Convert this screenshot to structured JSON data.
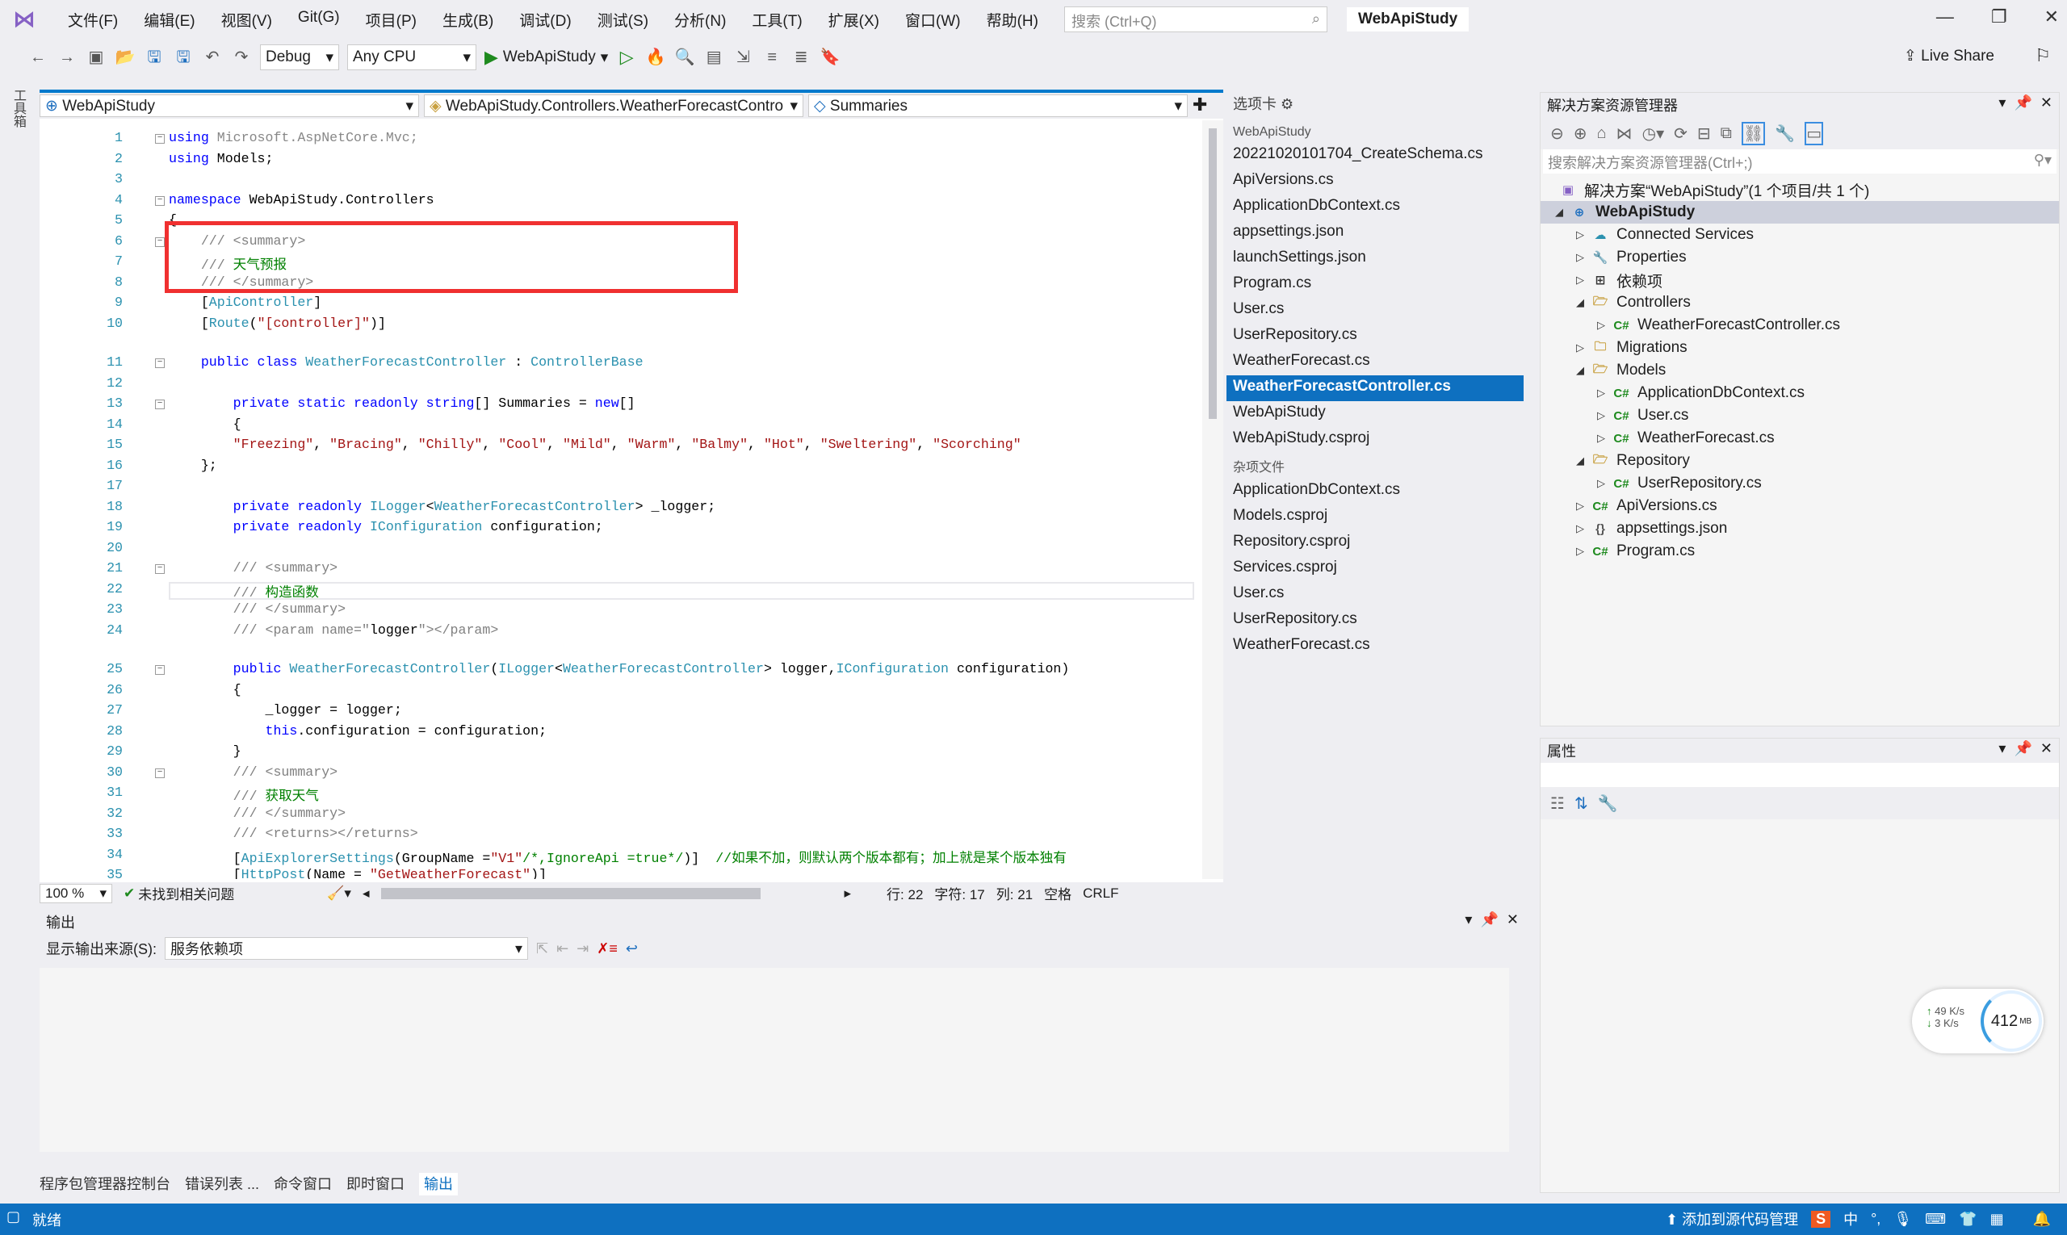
{
  "menubar": {
    "items": [
      "文件(F)",
      "编辑(E)",
      "视图(V)",
      "Git(G)",
      "项目(P)",
      "生成(B)",
      "调试(D)",
      "测试(S)",
      "分析(N)",
      "工具(T)",
      "扩展(X)",
      "窗口(W)",
      "帮助(H)"
    ],
    "search_placeholder": "搜索 (Ctrl+Q)",
    "title": "WebApiStudy"
  },
  "toolbar": {
    "config": "Debug",
    "platform": "Any CPU",
    "run_target": "WebApiStudy",
    "live_share": "Live Share"
  },
  "left_rail": {
    "label": "工具箱"
  },
  "editor": {
    "nav": {
      "project": "WebApiStudy",
      "class": "WebApiStudy.Controllers.WeatherForecastContro",
      "member": "Summaries"
    },
    "lines": [
      [
        [
          "kw",
          "using"
        ],
        [
          "fd",
          " Microsoft.AspNetCore.Mvc;"
        ]
      ],
      [
        [
          "kw",
          "using"
        ],
        [
          "tx",
          " Models;"
        ]
      ],
      [],
      [
        [
          "kw",
          "namespace"
        ],
        [
          "tx",
          " WebApiStudy.Controllers"
        ]
      ],
      [
        [
          "tx",
          "{"
        ]
      ],
      [
        [
          "dc",
          "    /// <summary>"
        ]
      ],
      [
        [
          "dc",
          "    /// "
        ],
        [
          "cm",
          "天气预报"
        ]
      ],
      [
        [
          "dc",
          "    /// </summary>"
        ]
      ],
      [
        [
          "tx",
          "    ["
        ],
        [
          "ty",
          "ApiController"
        ],
        [
          "tx",
          "]"
        ]
      ],
      [
        [
          "tx",
          "    ["
        ],
        [
          "ty",
          "Route"
        ],
        [
          "tx",
          "("
        ],
        [
          "st",
          "\"[controller]\""
        ],
        [
          "tx",
          ")]"
        ]
      ],
      [
        [
          "kw",
          "    public class "
        ],
        [
          "ty",
          "WeatherForecastController"
        ],
        [
          "tx",
          " : "
        ],
        [
          "ty",
          "ControllerBase"
        ]
      ],
      [],
      [
        [
          "kw",
          "        private static readonly string"
        ],
        [
          "tx",
          "[] Summaries = "
        ],
        [
          "kw",
          "new"
        ],
        [
          "tx",
          "[]"
        ]
      ],
      [
        [
          "tx",
          "        {"
        ]
      ],
      [
        [
          "st",
          "        \"Freezing\""
        ],
        [
          "tx",
          ", "
        ],
        [
          "st",
          "\"Bracing\""
        ],
        [
          "tx",
          ", "
        ],
        [
          "st",
          "\"Chilly\""
        ],
        [
          "tx",
          ", "
        ],
        [
          "st",
          "\"Cool\""
        ],
        [
          "tx",
          ", "
        ],
        [
          "st",
          "\"Mild\""
        ],
        [
          "tx",
          ", "
        ],
        [
          "st",
          "\"Warm\""
        ],
        [
          "tx",
          ", "
        ],
        [
          "st",
          "\"Balmy\""
        ],
        [
          "tx",
          ", "
        ],
        [
          "st",
          "\"Hot\""
        ],
        [
          "tx",
          ", "
        ],
        [
          "st",
          "\"Sweltering\""
        ],
        [
          "tx",
          ", "
        ],
        [
          "st",
          "\"Scorching\""
        ]
      ],
      [
        [
          "tx",
          "    };"
        ]
      ],
      [],
      [
        [
          "kw",
          "        private readonly "
        ],
        [
          "ty",
          "ILogger"
        ],
        [
          "tx",
          "<"
        ],
        [
          "ty",
          "WeatherForecastController"
        ],
        [
          "tx",
          "> _logger;"
        ]
      ],
      [
        [
          "kw",
          "        private readonly "
        ],
        [
          "ty",
          "IConfiguration"
        ],
        [
          "tx",
          " configuration;"
        ]
      ],
      [],
      [
        [
          "dc",
          "        /// <summary>"
        ]
      ],
      [
        [
          "dc",
          "        /// "
        ],
        [
          "cm",
          "构造函数"
        ]
      ],
      [
        [
          "dc",
          "        /// </summary>"
        ]
      ],
      [
        [
          "dc",
          "        /// <param name=\""
        ],
        [
          "tx",
          "logger"
        ],
        [
          "dc",
          "\"></param>"
        ]
      ],
      [
        [
          "kw",
          "        public "
        ],
        [
          "ty",
          "WeatherForecastController"
        ],
        [
          "tx",
          "("
        ],
        [
          "ty",
          "ILogger"
        ],
        [
          "tx",
          "<"
        ],
        [
          "ty",
          "WeatherForecastController"
        ],
        [
          "tx",
          "> logger,"
        ],
        [
          "ty",
          "IConfiguration"
        ],
        [
          "tx",
          " configuration)"
        ]
      ],
      [
        [
          "tx",
          "        {"
        ]
      ],
      [
        [
          "tx",
          "            _logger = logger;"
        ]
      ],
      [
        [
          "kw",
          "            this"
        ],
        [
          "tx",
          ".configuration = configuration;"
        ]
      ],
      [
        [
          "tx",
          "        }"
        ]
      ],
      [
        [
          "dc",
          "        /// <summary>"
        ]
      ],
      [
        [
          "dc",
          "        /// "
        ],
        [
          "cm",
          "获取天气"
        ]
      ],
      [
        [
          "dc",
          "        /// </summary>"
        ]
      ],
      [
        [
          "dc",
          "        /// <returns></returns>"
        ]
      ],
      [
        [
          "tx",
          "        ["
        ],
        [
          "ty",
          "ApiExplorerSettings"
        ],
        [
          "tx",
          "(GroupName ="
        ],
        [
          "st",
          "\"V1\""
        ],
        [
          "cm",
          "/*,IgnoreApi =true*/"
        ],
        [
          "tx",
          ")]  "
        ],
        [
          "cm",
          "//如果不加，则默认两个版本都有；加上就是某个版本独有"
        ]
      ],
      [
        [
          "tx",
          "        ["
        ],
        [
          "ty",
          "HttpPost"
        ],
        [
          "tx",
          "(Name = "
        ],
        [
          "st",
          "\"GetWeatherForecast\""
        ],
        [
          "tx",
          ")]"
        ]
      ]
    ],
    "status": {
      "zoom": "100 %",
      "issues": "未找到相关问题",
      "line": "行: 22",
      "char": "字符: 17",
      "col": "列: 21",
      "spaces": "空格",
      "eol": "CRLF"
    }
  },
  "toolbox": {
    "title": "选项卡",
    "group1": "WebApiStudy",
    "items1": [
      "20221020101704_CreateSchema.cs",
      "ApiVersions.cs",
      "ApplicationDbContext.cs",
      "appsettings.json",
      "launchSettings.json",
      "Program.cs",
      "User.cs",
      "UserRepository.cs",
      "WeatherForecast.cs",
      "WeatherForecastController.cs",
      "WebApiStudy",
      "WebApiStudy.csproj"
    ],
    "selected": "WeatherForecastController.cs",
    "group2": "杂项文件",
    "items2": [
      "ApplicationDbContext.cs",
      "Models.csproj",
      "Repository.csproj",
      "Services.csproj",
      "User.cs",
      "UserRepository.cs",
      "WeatherForecast.cs"
    ]
  },
  "solution_explorer": {
    "title": "解决方案资源管理器",
    "search_placeholder": "搜索解决方案资源管理器(Ctrl+;)",
    "solution": "解决方案“WebApiStudy”(1 个项目/共 1 个)",
    "tree": [
      {
        "label": "WebApiStudy",
        "level": 0,
        "exp": "open",
        "icon": "project-icon",
        "sel": true
      },
      {
        "label": "Connected Services",
        "level": 1,
        "exp": "closed",
        "icon": "connected-services-icon"
      },
      {
        "label": "Properties",
        "level": 1,
        "exp": "closed",
        "icon": "properties-icon"
      },
      {
        "label": "依赖项",
        "level": 1,
        "exp": "closed",
        "icon": "dependencies-icon"
      },
      {
        "label": "Controllers",
        "level": 1,
        "exp": "open",
        "icon": "folder-open-icon"
      },
      {
        "label": "WeatherForecastController.cs",
        "level": 2,
        "exp": "closed",
        "icon": "csharp-file-icon"
      },
      {
        "label": "Migrations",
        "level": 1,
        "exp": "closed",
        "icon": "folder-icon"
      },
      {
        "label": "Models",
        "level": 1,
        "exp": "open",
        "icon": "folder-open-icon"
      },
      {
        "label": "ApplicationDbContext.cs",
        "level": 2,
        "exp": "closed",
        "icon": "csharp-file-icon"
      },
      {
        "label": "User.cs",
        "level": 2,
        "exp": "closed",
        "icon": "csharp-file-icon"
      },
      {
        "label": "WeatherForecast.cs",
        "level": 2,
        "exp": "closed",
        "icon": "csharp-file-icon"
      },
      {
        "label": "Repository",
        "level": 1,
        "exp": "open",
        "icon": "folder-open-icon"
      },
      {
        "label": "UserRepository.cs",
        "level": 2,
        "exp": "closed",
        "icon": "csharp-file-icon"
      },
      {
        "label": "ApiVersions.cs",
        "level": 1,
        "exp": "closed",
        "icon": "csharp-file-icon"
      },
      {
        "label": "appsettings.json",
        "level": 1,
        "exp": "closed",
        "icon": "json-file-icon"
      },
      {
        "label": "Program.cs",
        "level": 1,
        "exp": "closed",
        "icon": "csharp-file-icon"
      }
    ]
  },
  "properties": {
    "title": "属性"
  },
  "output": {
    "title": "输出",
    "source_label": "显示输出来源(S):",
    "source_value": "服务依赖项"
  },
  "bottom_tabs": [
    "程序包管理器控制台",
    "错误列表 ...",
    "命令窗口",
    "即时窗口",
    "输出"
  ],
  "statusbar": {
    "ready": "就绪",
    "add_source": "添加到源代码管理",
    "ime": "中"
  },
  "network": {
    "up": "49 K/s",
    "down": "3 K/s",
    "memory": "412",
    "memory_unit": "MB"
  },
  "colors": {
    "accent": "#0e70c0",
    "highlight_box": "#f03030",
    "keyword": "#0000ff",
    "type": "#2b91af",
    "string": "#a31515",
    "comment": "#008000"
  }
}
